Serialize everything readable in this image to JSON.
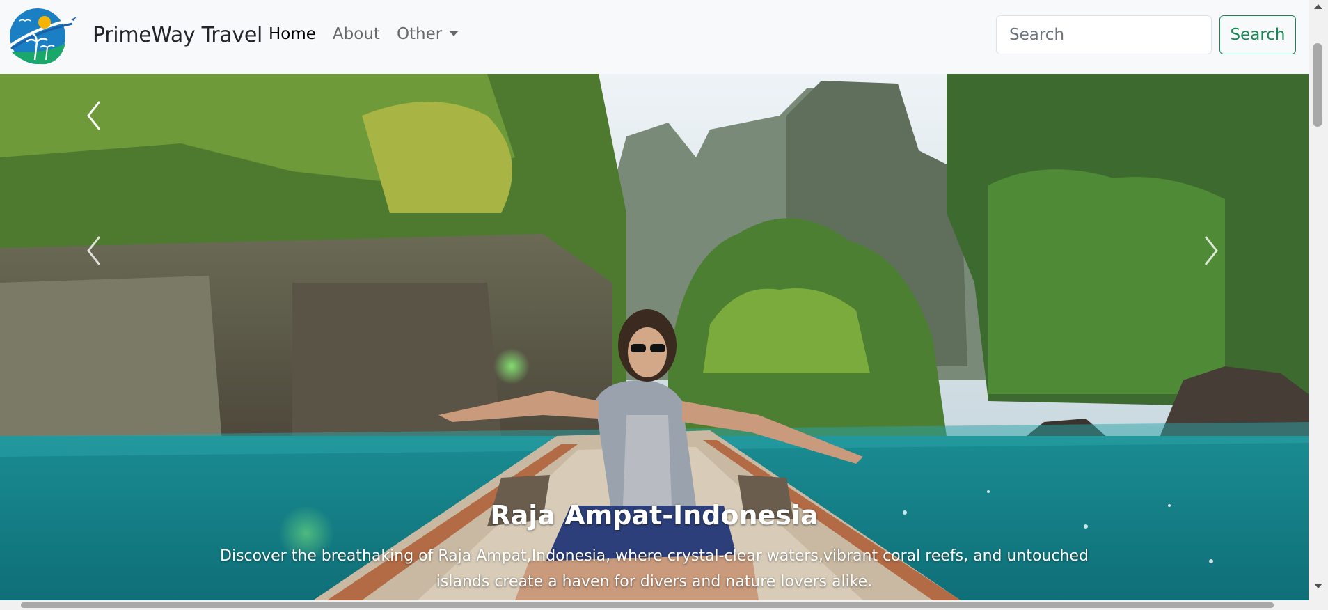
{
  "navbar": {
    "brand": "PrimeWay Travel",
    "links": [
      "Home",
      "About",
      "Other"
    ],
    "search_placeholder": "Search",
    "search_button": "Search"
  },
  "carousel": {
    "caption_title": "Raja Ampat-Indonesia",
    "caption_text": "Discover the breathaking of Raja Ampat,Indonesia, where crystal-clear waters,vibrant coral reefs, and untouched islands create a haven for divers and nature lovers alike."
  },
  "colors": {
    "navbar_bg": "#f8f9fa",
    "search_button": "#198754",
    "water": "#1e9aa0"
  },
  "icons": [
    "logo-icon",
    "chevron-left-icon",
    "chevron-right-icon",
    "caret-down-icon"
  ]
}
